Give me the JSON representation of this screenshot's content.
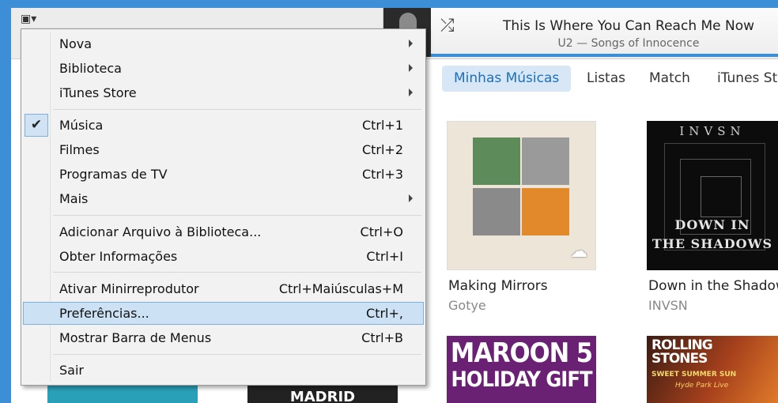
{
  "now_playing": {
    "title": "This Is Where You Can Reach Me Now",
    "subtitle": "U2 — Songs of Innocence"
  },
  "tabs": [
    {
      "label": "Minhas Músicas",
      "active": true
    },
    {
      "label": "Listas",
      "active": false
    },
    {
      "label": "Match",
      "active": false
    },
    {
      "label": "iTunes St",
      "active": false
    }
  ],
  "albums": [
    {
      "title": "Making Mirrors",
      "artist": "Gotye"
    },
    {
      "title": "Down in the Shadow",
      "artist": "INVSN",
      "art_top": "INVSN",
      "art_line1": "DOWN IN",
      "art_line2": "THE SHADOWS"
    },
    {
      "art_line1": "MAROON 5",
      "art_line2": "HOLIDAY GIFT"
    },
    {
      "art_line1": "ROLLING",
      "art_line2": "STONES",
      "art_line3": "SWEET SUMMER SUN",
      "art_line4": "Hyde Park Live"
    },
    {
      "art_text": "MADRID"
    }
  ],
  "menu": {
    "items": [
      {
        "label": "Nova",
        "shortcut": "",
        "submenu": true
      },
      {
        "label": "Biblioteca",
        "shortcut": "",
        "submenu": true
      },
      {
        "label": "iTunes Store",
        "shortcut": "",
        "submenu": true
      },
      {
        "label": "Música",
        "shortcut": "Ctrl+1",
        "checked": true
      },
      {
        "label": "Filmes",
        "shortcut": "Ctrl+2"
      },
      {
        "label": "Programas de TV",
        "shortcut": "Ctrl+3"
      },
      {
        "label": "Mais",
        "shortcut": "",
        "submenu": true
      },
      {
        "label": "Adicionar Arquivo à Biblioteca...",
        "shortcut": "Ctrl+O"
      },
      {
        "label": "Obter Informações",
        "shortcut": "Ctrl+I"
      },
      {
        "label": "Ativar Minirreprodutor",
        "shortcut": "Ctrl+Maiúsculas+M"
      },
      {
        "label": "Preferências...",
        "shortcut": "Ctrl+,",
        "highlighted": true
      },
      {
        "label": "Mostrar Barra de Menus",
        "shortcut": "Ctrl+B"
      },
      {
        "label": "Sair",
        "shortcut": ""
      }
    ]
  },
  "colors": {
    "accent": "#3c8fd6",
    "highlight": "#cce1f3",
    "tab_active_bg": "#d7e7f6"
  },
  "icons": {
    "shuffle": "shuffle-icon",
    "check": "checkmark-icon",
    "submenu": "submenu-arrow-icon",
    "cloud": "cloud-icon"
  }
}
